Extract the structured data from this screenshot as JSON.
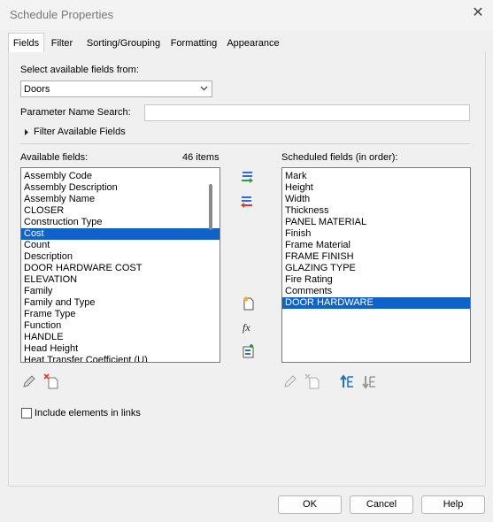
{
  "window": {
    "title": "Schedule Properties",
    "close_glyph": "✕"
  },
  "tabs": [
    {
      "label": "Fields"
    },
    {
      "label": "Filter"
    },
    {
      "label": "Sorting/Grouping"
    },
    {
      "label": "Formatting"
    },
    {
      "label": "Appearance"
    }
  ],
  "fields": {
    "select_label": "Select available fields from:",
    "category_value": "Doors",
    "param_search_label": "Parameter Name Search:",
    "param_search_value": "",
    "filter_available_label": "Filter Available Fields",
    "available_label": "Available fields:",
    "item_count": "46 items",
    "available_items": [
      "Assembly Code",
      "Assembly Description",
      "Assembly Name",
      "CLOSER",
      "Construction Type",
      "Cost",
      "Count",
      "Description",
      "DOOR HARDWARE COST",
      "ELEVATION",
      "Family",
      "Family and Type",
      "Frame Type",
      "Function",
      "HANDLE",
      "Head Height",
      "Heat Transfer Coefficient (U)"
    ],
    "available_selected_index": 5,
    "scheduled_label": "Scheduled fields (in order):",
    "scheduled_items": [
      "Mark",
      "Height",
      "Width",
      "Thickness",
      "PANEL MATERIAL",
      "Finish",
      "Frame Material",
      "FRAME FINISH",
      "GLAZING TYPE",
      "Fire Rating",
      "Comments",
      "DOOR HARDWARE"
    ],
    "scheduled_selected_index": 11,
    "include_links_label": "Include elements in links",
    "include_links_checked": false
  },
  "buttons": {
    "ok": "OK",
    "cancel": "Cancel",
    "help": "Help"
  },
  "icons": {
    "add": "add-parameter-icon",
    "remove": "remove-parameter-icon",
    "new_param": "new-parameter-icon",
    "calc": "calculated-value-icon",
    "combine": "combine-parameters-icon",
    "edit": "edit-parameter-icon",
    "delete": "delete-parameter-icon",
    "move_up": "move-up-icon",
    "move_down": "move-down-icon"
  },
  "colors": {
    "selection": "#0f62c9",
    "add_arrow": "#2f9a4a",
    "remove_arrow": "#d83b2b",
    "move_arrow": "#1f6fc5"
  }
}
